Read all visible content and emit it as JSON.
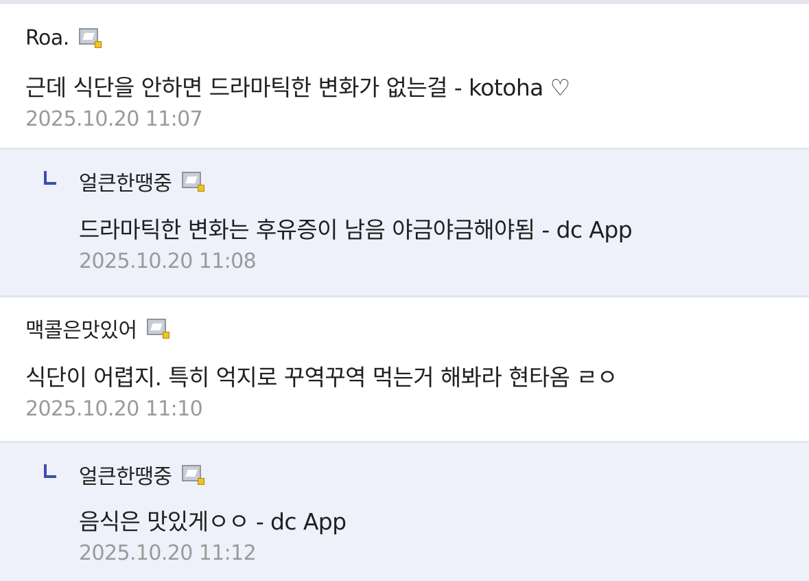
{
  "comments": [
    {
      "nick": "Roa.",
      "text": "근데 식단을 안하면 드라마틱한 변화가 없는걸 - kotoha ♡",
      "time": "2025.10.20 11:07"
    },
    {
      "nick": "얼큰한땡중",
      "text": "드라마틱한 변화는 후유증이 남음 야금야금해야됨 - dc App",
      "time": "2025.10.20 11:08"
    },
    {
      "nick": "맥콜은맛있어",
      "text": "식단이 어렵지. 특히 억지로 꾸역꾸역 먹는거 해봐라 현타옴 ㄹㅇ",
      "time": "2025.10.20 11:10"
    },
    {
      "nick": "얼큰한땡중",
      "text": "음식은 맛있게ㅇㅇ - dc App",
      "time": "2025.10.20 11:12"
    }
  ],
  "icons": {
    "gallery_icon": "fixed-nick-gallery-icon",
    "reply_mark": "reply-arrow-icon"
  },
  "colors": {
    "reply_background": "#eff1fa",
    "divider": "#e3e6ef",
    "reply_mark": "#3e4db0",
    "timestamp": "#9a9a9a"
  }
}
